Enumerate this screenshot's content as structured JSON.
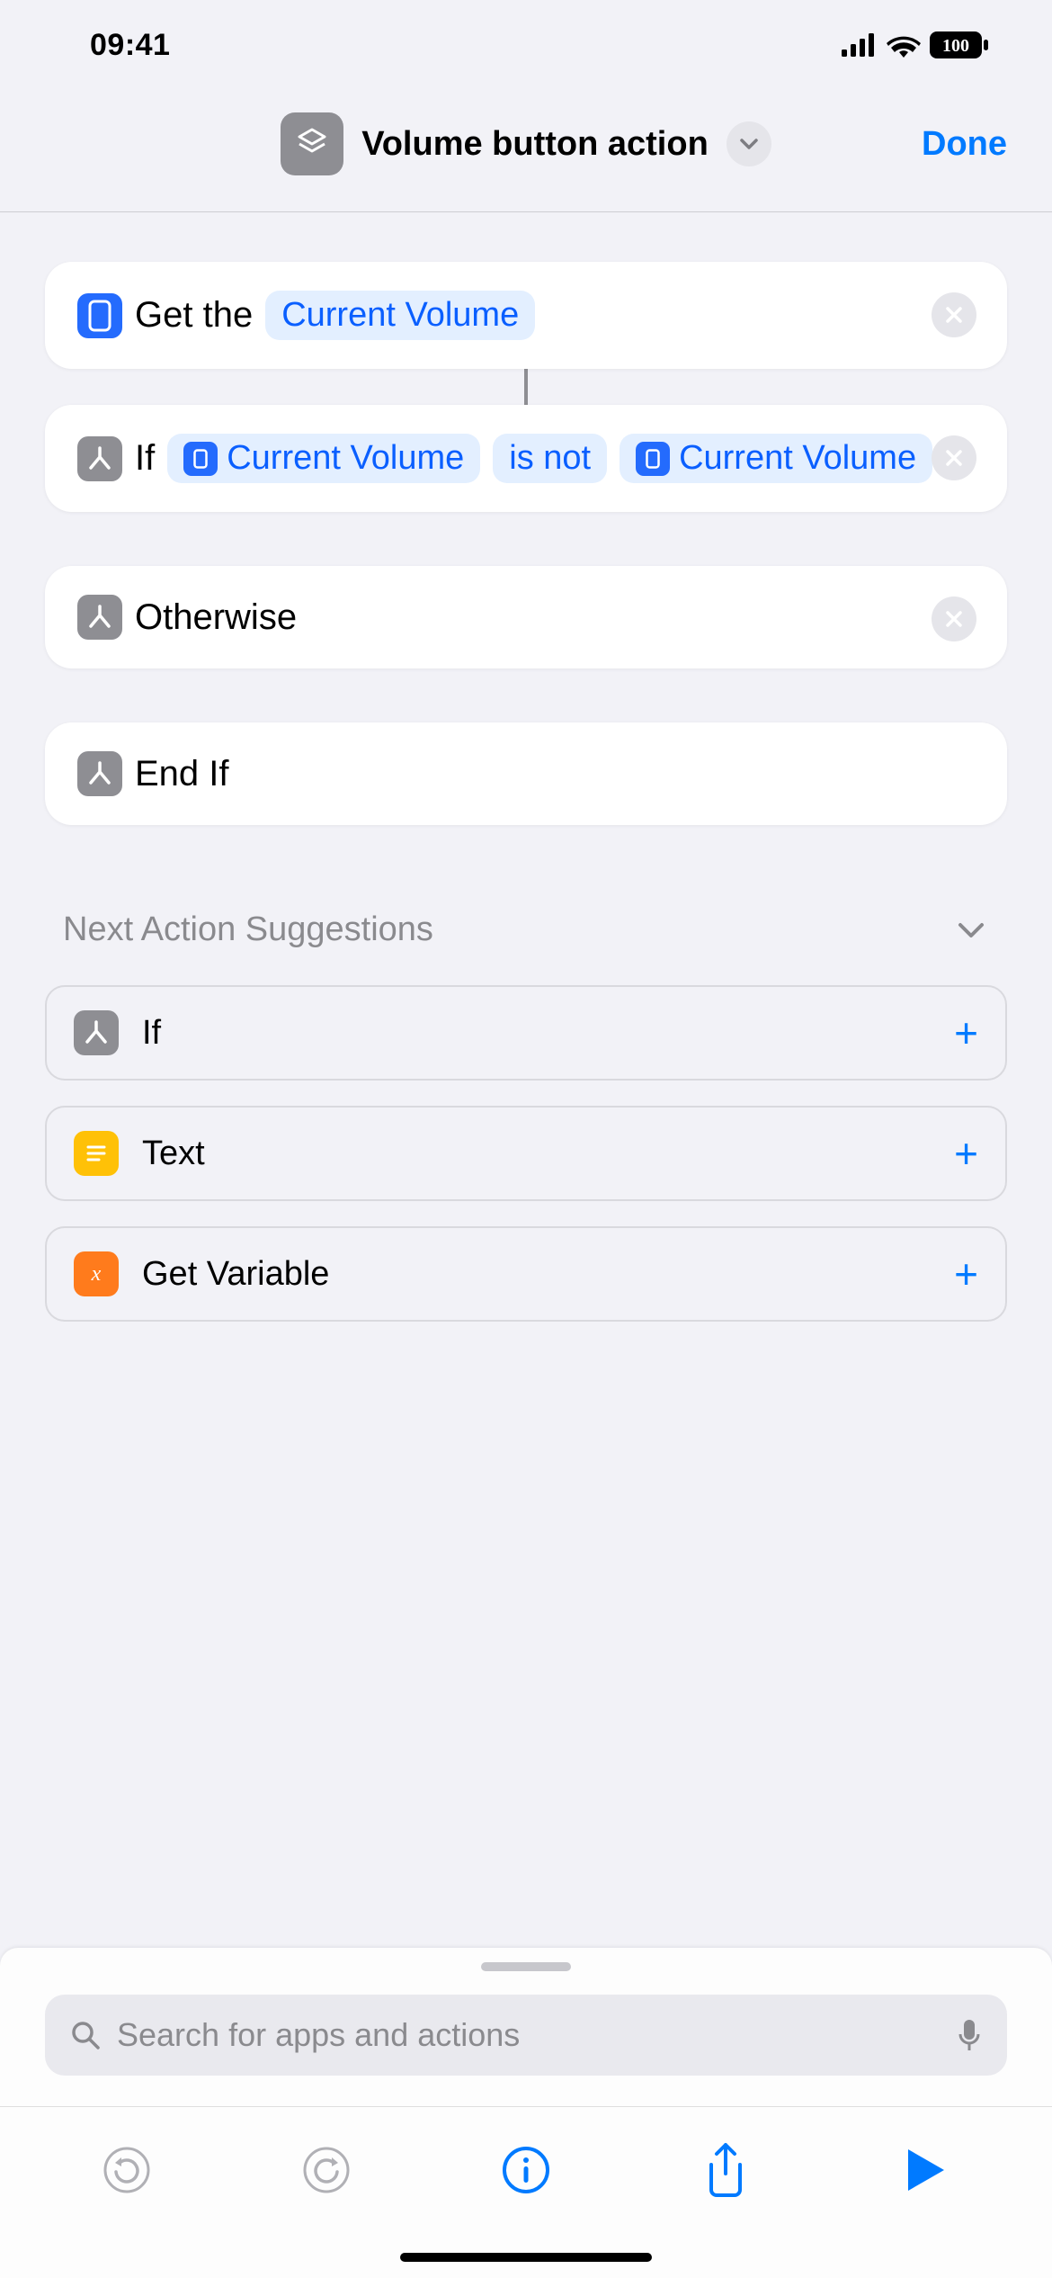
{
  "status": {
    "time": "09:41",
    "battery": "100"
  },
  "header": {
    "title": "Volume button action",
    "done": "Done"
  },
  "actions": {
    "get_volume": {
      "text": "Get the",
      "param": "Current Volume"
    },
    "if_block": {
      "label": "If",
      "var1": "Current Volume",
      "cond": "is not",
      "var2": "Current Volume"
    },
    "otherwise": {
      "label": "Otherwise"
    },
    "endif": {
      "label": "End If"
    }
  },
  "suggestions": {
    "title": "Next Action Suggestions",
    "items": {
      "if": "If",
      "text": "Text",
      "get_variable": "Get Variable"
    }
  },
  "search": {
    "placeholder": "Search for apps and actions"
  }
}
